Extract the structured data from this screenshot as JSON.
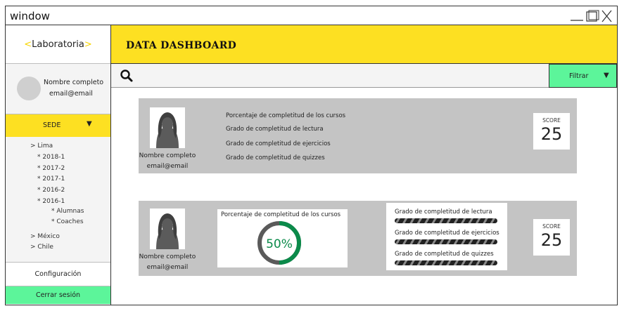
{
  "window": {
    "title": "window"
  },
  "sidebar": {
    "brand": "Laboratoria",
    "user_name": "Nombre completo",
    "user_email": "email@email",
    "sede_label": "SEDE",
    "tree": [
      "> Lima",
      "* 2018-1",
      "* 2017-2",
      "* 2017-1",
      "* 2016-2",
      "* 2016-1",
      "* Alumnas",
      "* Coaches",
      "> México",
      "> Chile"
    ],
    "config_label": "Configuración",
    "logout_label": "Cerrar sesión"
  },
  "header": {
    "title": "DATA DASHBOARD"
  },
  "search": {
    "filter_label": "Filtrar"
  },
  "cards": [
    {
      "name": "Nombre completo",
      "email": "email@email",
      "metrics": [
        "Porcentaje de completitud de los cursos",
        "Grado de completitud de lectura",
        "Grado de completitud de ejercicios",
        "Grado de completitud de quizzes"
      ],
      "score_label": "SCORE",
      "score_value": "25"
    },
    {
      "name": "Nombre completo",
      "email": "email@email",
      "course_label": "Porcentaje de completitud de los cursos",
      "course_percent_text": "50%",
      "course_percent": 50,
      "bars": [
        {
          "label": "Grado de completitud de lectura"
        },
        {
          "label": "Grado de completitud de ejercicios"
        },
        {
          "label": "Grado de completitud de quizzes"
        }
      ],
      "score_label": "SCORE",
      "score_value": "25"
    }
  ],
  "colors": {
    "accent_yellow": "#fde022",
    "accent_green": "#5cf59a",
    "progress_green": "#0b8a4a",
    "card_gray": "#c4c4c4"
  }
}
